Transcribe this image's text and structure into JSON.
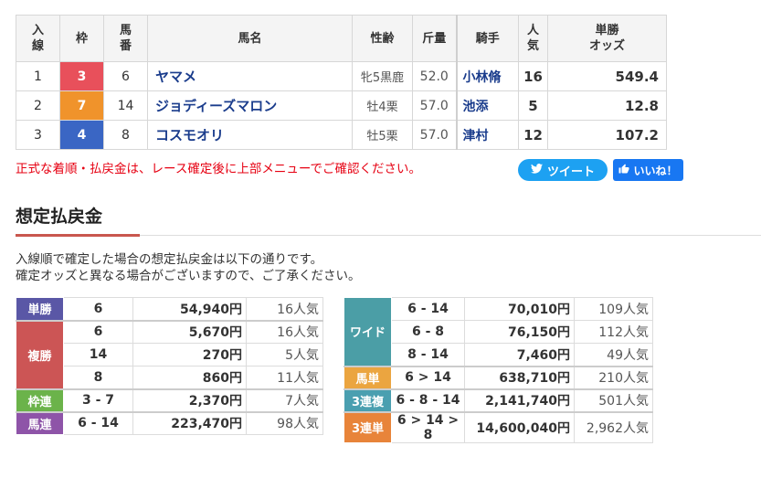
{
  "result_table": {
    "headers": {
      "rank": "入\n線",
      "waku": "枠",
      "uma": "馬\n番",
      "name": "馬名",
      "sexage": "性齢",
      "kin": "斤量",
      "jockey": "騎手",
      "ninki": "人\n気",
      "odds": "単勝\nオッズ"
    },
    "rows": [
      {
        "rank": "1",
        "waku": "3",
        "waku_color": "#e8505b",
        "uma": "6",
        "name": "ヤマメ",
        "sexage": "牝5黒鹿",
        "kin": "52.0",
        "jockey": "小林脩",
        "ninki": "16",
        "odds": "549.4"
      },
      {
        "rank": "2",
        "waku": "7",
        "waku_color": "#f0932b",
        "uma": "14",
        "name": "ジョディーズマロン",
        "sexage": "牡4栗",
        "kin": "57.0",
        "jockey": "池添",
        "ninki": "5",
        "odds": "12.8"
      },
      {
        "rank": "3",
        "waku": "4",
        "waku_color": "#3a66c4",
        "uma": "8",
        "name": "コスモオリ",
        "sexage": "牡5栗",
        "kin": "57.0",
        "jockey": "津村",
        "ninki": "12",
        "odds": "107.2"
      }
    ]
  },
  "notice": "正式な着順・払戻金は、レース確定後に上部メニューでご確認ください。",
  "share": {
    "tweet_label": "ツイート",
    "like_label": "いいね！"
  },
  "section_title": "想定払戻金",
  "description": {
    "line1": "入線順で確定した場合の想定払戻金は以下の通りです。",
    "line2": "確定オッズと異なる場合がございますので、ご了承ください。"
  },
  "payouts_left": [
    {
      "label": "単勝",
      "color": "#5a57a6",
      "rows": [
        {
          "combo": "6",
          "amount": "54,940円",
          "ninki": "16人気"
        }
      ]
    },
    {
      "label": "複勝",
      "color": "#cc5555",
      "rows": [
        {
          "combo": "6",
          "amount": "5,670円",
          "ninki": "16人気"
        },
        {
          "combo": "14",
          "amount": "270円",
          "ninki": "5人気"
        },
        {
          "combo": "8",
          "amount": "860円",
          "ninki": "11人気"
        }
      ]
    },
    {
      "label": "枠連",
      "color": "#6bb34a",
      "rows": [
        {
          "combo": "3 - 7",
          "amount": "2,370円",
          "ninki": "7人気"
        }
      ]
    },
    {
      "label": "馬連",
      "color": "#8e54a8",
      "rows": [
        {
          "combo": "6 - 14",
          "amount": "223,470円",
          "ninki": "98人気"
        }
      ]
    }
  ],
  "payouts_right": [
    {
      "label": "ワイド",
      "color": "#4b9ea6",
      "rows": [
        {
          "combo": "6 - 14",
          "amount": "70,010円",
          "ninki": "109人気"
        },
        {
          "combo": "6 - 8",
          "amount": "76,150円",
          "ninki": "112人気"
        },
        {
          "combo": "8 - 14",
          "amount": "7,460円",
          "ninki": "49人気"
        }
      ]
    },
    {
      "label": "馬単",
      "color": "#eba540",
      "rows": [
        {
          "combo": "6 > 14",
          "amount": "638,710円",
          "ninki": "210人気"
        }
      ]
    },
    {
      "label": "3連複",
      "color": "#4a9fb0",
      "rows": [
        {
          "combo": "6 - 8 - 14",
          "amount": "2,141,740円",
          "ninki": "501人気"
        }
      ]
    },
    {
      "label": "3連単",
      "color": "#e8843a",
      "rows": [
        {
          "combo": "6 > 14 > 8",
          "amount": "14,600,040円",
          "ninki": "2,962人気"
        }
      ]
    }
  ]
}
